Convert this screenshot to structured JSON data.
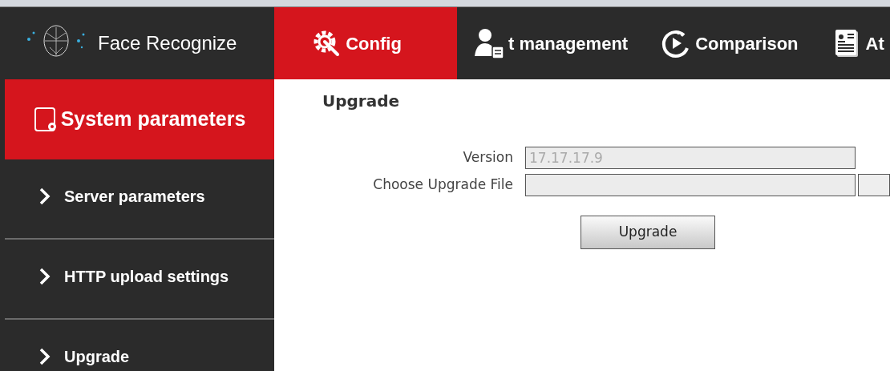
{
  "app": {
    "title": "Face Recognize"
  },
  "tabs": [
    {
      "label": "Config",
      "selected": true,
      "kind": "gear"
    },
    {
      "label": "t management",
      "selected": false,
      "kind": "person"
    },
    {
      "label": "Comparison",
      "selected": false,
      "kind": "timer"
    },
    {
      "label": "At",
      "selected": false,
      "kind": "card"
    }
  ],
  "sidebar": {
    "items": [
      {
        "label": "System parameters",
        "selected": true,
        "kind": "section"
      },
      {
        "label": "Server parameters",
        "selected": false,
        "kind": "link"
      },
      {
        "label": "HTTP upload settings",
        "selected": false,
        "kind": "link"
      },
      {
        "label": "Upgrade",
        "selected": false,
        "kind": "link"
      }
    ]
  },
  "panel": {
    "title": "Upgrade",
    "fields": [
      {
        "label": "Version",
        "value": "17.17.17.9",
        "disabled": true,
        "kind": "text"
      },
      {
        "label": "Choose Upgrade File",
        "disabled": true,
        "kind": "file"
      }
    ],
    "button": "Upgrade"
  }
}
